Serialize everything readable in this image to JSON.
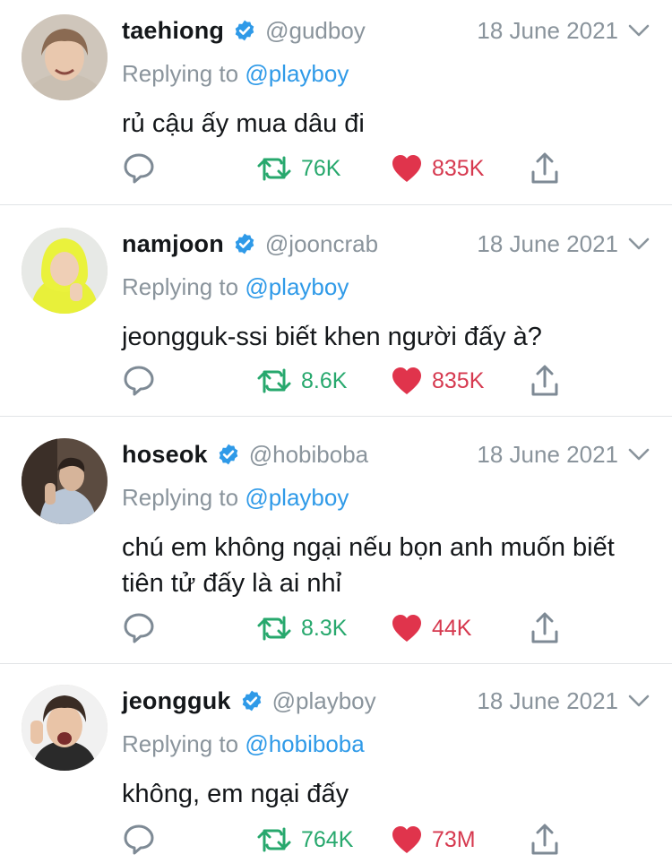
{
  "tweets": [
    {
      "name": "taehiong",
      "handle": "@gudboy",
      "date": "18 June 2021",
      "replying_prefix": "Replying to ",
      "replying_to": "@playboy",
      "text": "rủ cậu ấy mua dâu đi",
      "retweets": "76K",
      "likes": "835K",
      "avatar_icon": "avatar-taehiong"
    },
    {
      "name": "namjoon",
      "handle": "@jooncrab",
      "date": "18 June 2021",
      "replying_prefix": "Replying to ",
      "replying_to": "@playboy",
      "text": "jeongguk-ssi biết khen người đấy à?",
      "retweets": "8.6K",
      "likes": "835K",
      "avatar_icon": "avatar-namjoon"
    },
    {
      "name": "hoseok",
      "handle": "@hobiboba",
      "date": "18 June 2021",
      "replying_prefix": "Replying to ",
      "replying_to": "@playboy",
      "text": "chú em không ngại nếu bọn anh muốn biết tiên tử đấy là ai nhỉ",
      "retweets": "8.3K",
      "likes": "44K",
      "avatar_icon": "avatar-hoseok"
    },
    {
      "name": "jeongguk",
      "handle": "@playboy",
      "date": "18 June 2021",
      "replying_prefix": "Replying to ",
      "replying_to": "@hobiboba",
      "text": "không, em ngại đấy",
      "retweets": "764K",
      "likes": "73M",
      "avatar_icon": "avatar-jeongguk"
    }
  ],
  "colors": {
    "verified": "#2f9ae8",
    "mention": "#2f9ae8",
    "retweet": "#27a86d",
    "like": "#d6394f",
    "secondary_text": "#8a949c",
    "icon": "#7e8a95"
  },
  "icons": [
    "verified-badge-icon",
    "chevron-down-icon",
    "reply-icon",
    "retweet-icon",
    "heart-icon",
    "share-icon"
  ]
}
